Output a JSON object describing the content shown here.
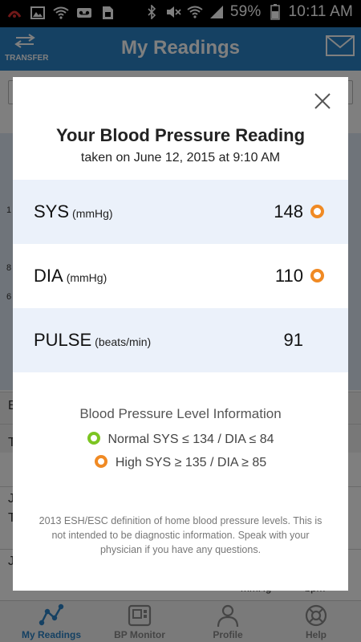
{
  "status_bar": {
    "battery": "59%",
    "time": "10:11 AM"
  },
  "header": {
    "transfer_label": "TRANSFER",
    "title": "My Readings"
  },
  "background": {
    "tick_1": "1",
    "tick_2": "8",
    "tick_3": "6",
    "row_letters": [
      "E",
      "T",
      "J",
      "T",
      "J"
    ],
    "unit_mmhg": "mmHg",
    "unit_bpm": "bpm"
  },
  "tabs": [
    {
      "label": "My Readings",
      "icon": "line-graph-icon",
      "active": true
    },
    {
      "label": "BP Monitor",
      "icon": "bp-monitor-icon",
      "active": false
    },
    {
      "label": "Profile",
      "icon": "person-icon",
      "active": false
    },
    {
      "label": "Help",
      "icon": "lifebuoy-icon",
      "active": false
    }
  ],
  "modal": {
    "title": "Your Blood Pressure Reading",
    "subtitle": "taken on June 12, 2015 at 9:10 AM",
    "readings": [
      {
        "label": "SYS",
        "unit": "(mmHg)",
        "value": "148",
        "level": "high"
      },
      {
        "label": "DIA",
        "unit": "(mmHg)",
        "value": "110",
        "level": "high"
      },
      {
        "label": "PULSE",
        "unit": "(beats/min)",
        "value": "91",
        "level": ""
      }
    ],
    "info_heading": "Blood Pressure Level Information",
    "legend": [
      {
        "text": "Normal SYS ≤ 134 / DIA ≤ 84",
        "color": "#7cc522"
      },
      {
        "text": "High SYS ≥ 135 / DIA ≥ 85",
        "color": "#f08a24"
      }
    ],
    "footnote": "2013 ESH/ESC definition of home blood pressure levels. This is not intended to be diagnostic information. Speak with your physician if you have any questions."
  },
  "colors": {
    "accent": "#2a82c6",
    "high": "#f08a24",
    "normal": "#7cc522",
    "row_shade": "#ebf1fa"
  }
}
